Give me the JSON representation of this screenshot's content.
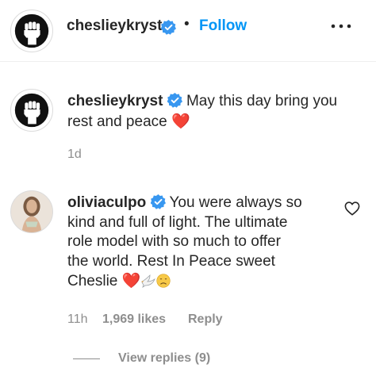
{
  "header": {
    "username": "cheslieykryst",
    "separator": "•",
    "follow_label": "Follow",
    "more_icon": "more-horizontal-icon"
  },
  "caption": {
    "username": "cheslieykryst",
    "text_line1": "May this day bring you",
    "text_line2": "rest and peace",
    "emoji": "❤️",
    "time": "1d"
  },
  "comment": {
    "username": "oliviaculpo",
    "text_line1": "You were always so",
    "text_line2": "kind and full of light. The ultimate",
    "text_line3": "role model with so much to offer",
    "text_line4": "the world. Rest In Peace sweet",
    "text_line5": "Cheslie",
    "emojis": [
      "❤️",
      "🕊️",
      "😞"
    ],
    "time": "11h",
    "likes": "1,969 likes",
    "reply_label": "Reply",
    "view_replies": "View replies (9)"
  },
  "colors": {
    "link_blue": "#0095f6",
    "verified_blue": "#3897f0",
    "secondary_text": "#8e8e8e",
    "heart_red": "#e0245e"
  }
}
